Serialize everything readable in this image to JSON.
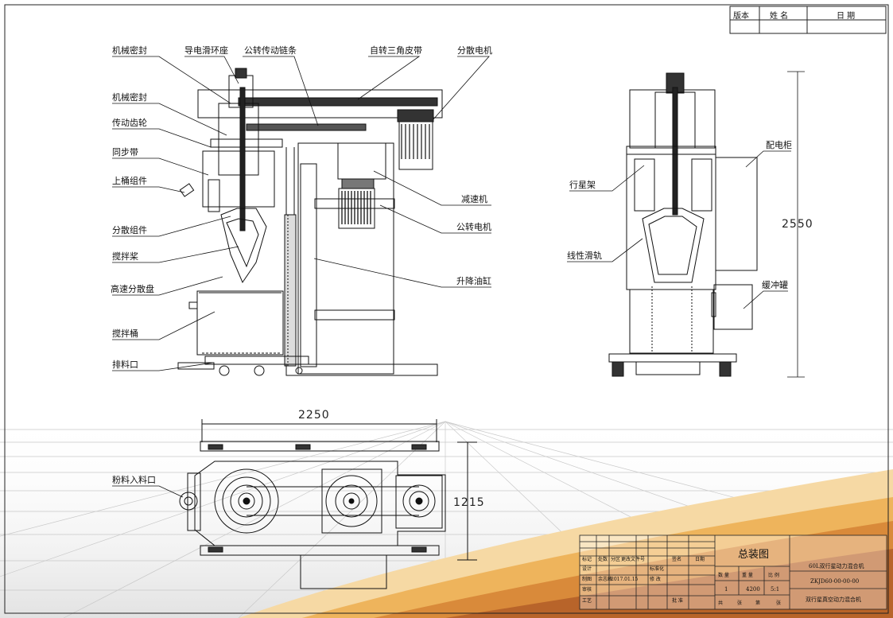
{
  "revision_table": {
    "headers": [
      "版本",
      "姓 名",
      "日 期"
    ]
  },
  "callouts_left": [
    "机械密封",
    "导电滑环座",
    "公转传动链条",
    "自转三角皮带",
    "分散电机",
    "机械密封",
    "传动齿轮",
    "同步带",
    "上桶组件",
    "分散组件",
    "搅拌桨",
    "高速分散盘",
    "搅拌桶",
    "排料口"
  ],
  "callouts_right": [
    "减速机",
    "公转电机",
    "升降油缸"
  ],
  "side_callouts": [
    "配电柜",
    "行星架",
    "线性滑轨",
    "缓冲罐"
  ],
  "plan_callout": "粉料入料口",
  "dimensions": {
    "height": "2550",
    "length": "2250",
    "width": "1215"
  },
  "title_block": {
    "row_headers": [
      "标记",
      "处数",
      "分区",
      "更改文件号",
      "签名",
      "日期"
    ],
    "row_design": [
      "设计",
      "标准化"
    ],
    "row_draw": [
      "制图",
      "余志峰",
      "2017.01.15",
      "修 改"
    ],
    "row_check": [
      "审核"
    ],
    "row_process": [
      "工艺",
      "批 准"
    ],
    "drawing_title": "总装图",
    "stat_headers": [
      "数 量",
      "重 量",
      "比 例"
    ],
    "stat_values": [
      "1",
      "4200",
      "5:1"
    ],
    "sheet_info": [
      "共",
      "张",
      "第",
      "张"
    ],
    "product_name": "60L双行星动力混合机",
    "drawing_number": "ZKJD60-00-00-00",
    "product_full": "双行星真空动力混合机"
  }
}
